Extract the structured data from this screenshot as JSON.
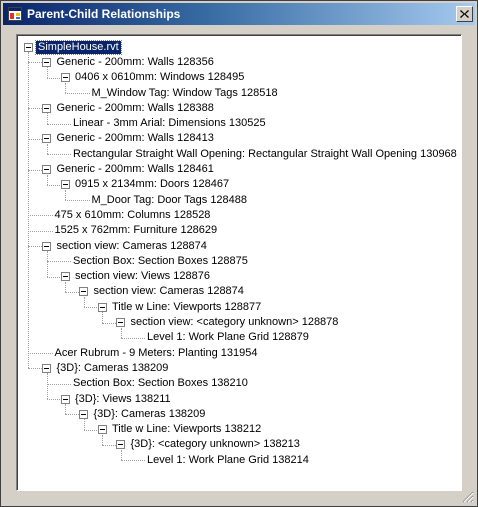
{
  "window": {
    "title": "Parent-Child Relationships",
    "close_glyph": "X"
  },
  "tree": {
    "nodes": [
      {
        "label": "SimpleHouse.rvt",
        "depth": 0,
        "expander": true,
        "selected": true
      },
      {
        "label": "Generic - 200mm: Walls 128356",
        "depth": 1,
        "expander": true
      },
      {
        "label": "0406 x 0610mm: Windows 128495",
        "depth": 2,
        "expander": true
      },
      {
        "label": "M_Window Tag: Window Tags 128518",
        "depth": 3,
        "expander": false
      },
      {
        "label": "Generic - 200mm: Walls 128388",
        "depth": 1,
        "expander": true
      },
      {
        "label": "Linear - 3mm Arial: Dimensions 130525",
        "depth": 2,
        "expander": false
      },
      {
        "label": "Generic - 200mm: Walls 128413",
        "depth": 1,
        "expander": true
      },
      {
        "label": "Rectangular Straight Wall Opening: Rectangular Straight Wall Opening 130968",
        "depth": 2,
        "expander": false
      },
      {
        "label": "Generic - 200mm: Walls 128461",
        "depth": 1,
        "expander": true
      },
      {
        "label": "0915 x 2134mm: Doors 128467",
        "depth": 2,
        "expander": true
      },
      {
        "label": "M_Door Tag: Door Tags 128488",
        "depth": 3,
        "expander": false
      },
      {
        "label": "475 x 610mm: Columns 128528",
        "depth": 1,
        "expander": false
      },
      {
        "label": "1525 x 762mm: Furniture 128629",
        "depth": 1,
        "expander": false
      },
      {
        "label": "section view: Cameras 128874",
        "depth": 1,
        "expander": true
      },
      {
        "label": "Section Box: Section Boxes 128875",
        "depth": 2,
        "expander": false
      },
      {
        "label": "section view: Views 128876",
        "depth": 2,
        "expander": true
      },
      {
        "label": "section view: Cameras 128874",
        "depth": 3,
        "expander": true
      },
      {
        "label": "Title w Line: Viewports 128877",
        "depth": 4,
        "expander": true
      },
      {
        "label": "section view: <category unknown> 128878",
        "depth": 5,
        "expander": true
      },
      {
        "label": "Level 1: Work Plane Grid 128879",
        "depth": 6,
        "expander": false
      },
      {
        "label": "Acer Rubrum - 9 Meters: Planting 131954",
        "depth": 1,
        "expander": false
      },
      {
        "label": "{3D}: Cameras 138209",
        "depth": 1,
        "expander": true
      },
      {
        "label": "Section Box: Section Boxes 138210",
        "depth": 2,
        "expander": false
      },
      {
        "label": "{3D}: Views 138211",
        "depth": 2,
        "expander": true
      },
      {
        "label": "{3D}: Cameras 138209",
        "depth": 3,
        "expander": true
      },
      {
        "label": "Title w Line: Viewports 138212",
        "depth": 4,
        "expander": true
      },
      {
        "label": "{3D}: <category unknown> 138213",
        "depth": 5,
        "expander": true
      },
      {
        "label": "Level 1: Work Plane Grid 138214",
        "depth": 6,
        "expander": false
      }
    ]
  },
  "colors": {
    "title_gradient_start": "#0a246a",
    "title_gradient_end": "#a6caf0",
    "selection_bg": "#0a246a",
    "window_face": "#d4d0c8"
  },
  "icons": {
    "app": "window-app-icon",
    "close": "close-icon",
    "grip": "resize-grip-icon",
    "expander": "tree-collapse-icon"
  }
}
